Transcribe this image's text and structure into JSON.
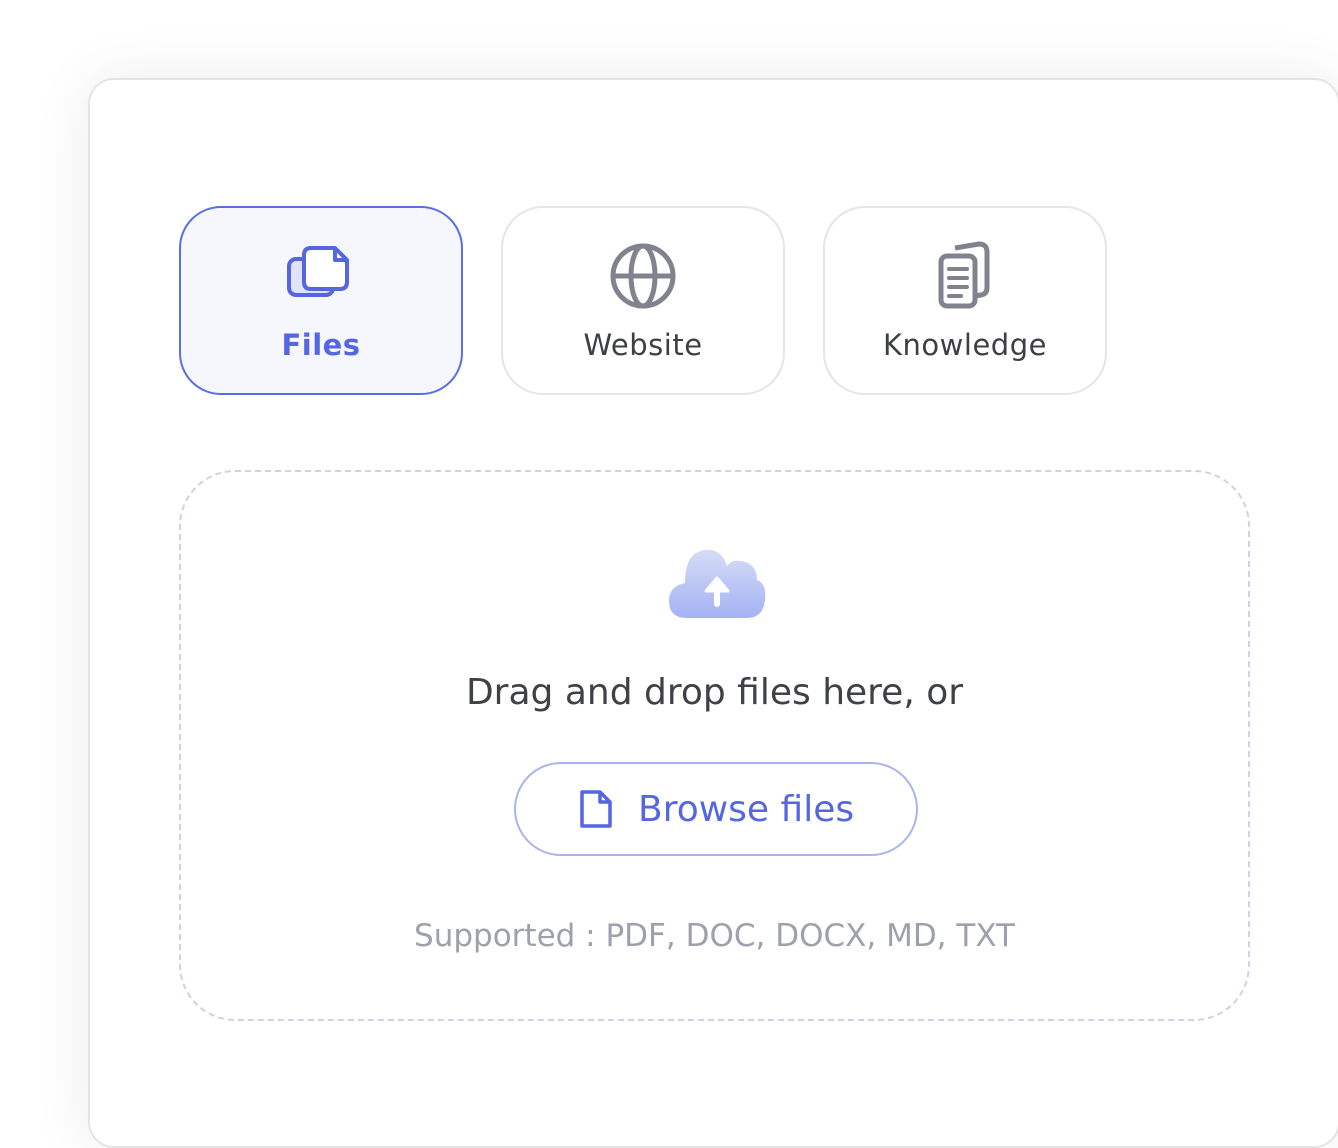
{
  "tabs": [
    {
      "label": "Files",
      "icon": "files-icon",
      "active": true
    },
    {
      "label": "Website",
      "icon": "globe-icon",
      "active": false
    },
    {
      "label": "Knowledge",
      "icon": "documents-icon",
      "active": false
    }
  ],
  "dropzone": {
    "icon": "cloud-upload-icon",
    "prompt": "Drag and drop files here, or",
    "browse_label": "Browse files",
    "browse_icon": "file-icon",
    "supported": "Supported : PDF, DOC, DOCX, MD, TXT"
  },
  "colors": {
    "accent": "#5467e0",
    "active_tab_border": "#5a6fe3",
    "active_tab_background": "#f6f7fc",
    "icon_gray": "#80838d",
    "cloud": "#a9b6f5"
  }
}
